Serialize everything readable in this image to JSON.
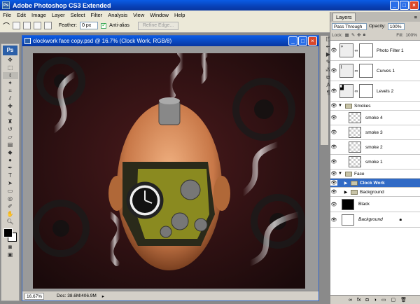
{
  "app": {
    "title": "Adobe Photoshop CS3 Extended",
    "logo": "Ps"
  },
  "menu": [
    "File",
    "Edit",
    "Image",
    "Layer",
    "Select",
    "Filter",
    "Analysis",
    "View",
    "Window",
    "Help"
  ],
  "options": {
    "feather_label": "Feather:",
    "feather_value": "0 px",
    "antialias_label": "Anti-alias",
    "refine_label": "Refine Edge..."
  },
  "document": {
    "title": "clockwork face copy.psd @ 16.7% (Clock Work, RGB/8)",
    "zoom": "16.67%",
    "doc_info": "Doc: 38.6M/406.9M"
  },
  "layers_panel": {
    "tab": "Layers",
    "blend_mode": "Pass Through",
    "opacity_label": "Opacity:",
    "opacity_value": "100%",
    "lock_label": "Lock:",
    "fill_label": "Fill:",
    "fill_value": "100%",
    "layers": [
      {
        "name": "Photo Filter 1",
        "kind": "adjustment"
      },
      {
        "name": "Curves 1",
        "kind": "adjustment"
      },
      {
        "name": "Levels 2",
        "kind": "adjustment"
      },
      {
        "name": "Smokes",
        "kind": "group"
      },
      {
        "name": "smoke 4",
        "kind": "layer"
      },
      {
        "name": "smoke 3",
        "kind": "layer"
      },
      {
        "name": "smoke 2",
        "kind": "layer"
      },
      {
        "name": "smoke 1",
        "kind": "layer"
      },
      {
        "name": "Face",
        "kind": "group"
      },
      {
        "name": "Clock Work",
        "kind": "group",
        "selected": true
      },
      {
        "name": "Background",
        "kind": "group"
      },
      {
        "name": "Black",
        "kind": "fill"
      },
      {
        "name": "Background",
        "kind": "background"
      }
    ]
  },
  "colors": {
    "accent": "#316ac5",
    "titlebar": "#0a5ce6",
    "canvas_bg": "#2a1214"
  }
}
